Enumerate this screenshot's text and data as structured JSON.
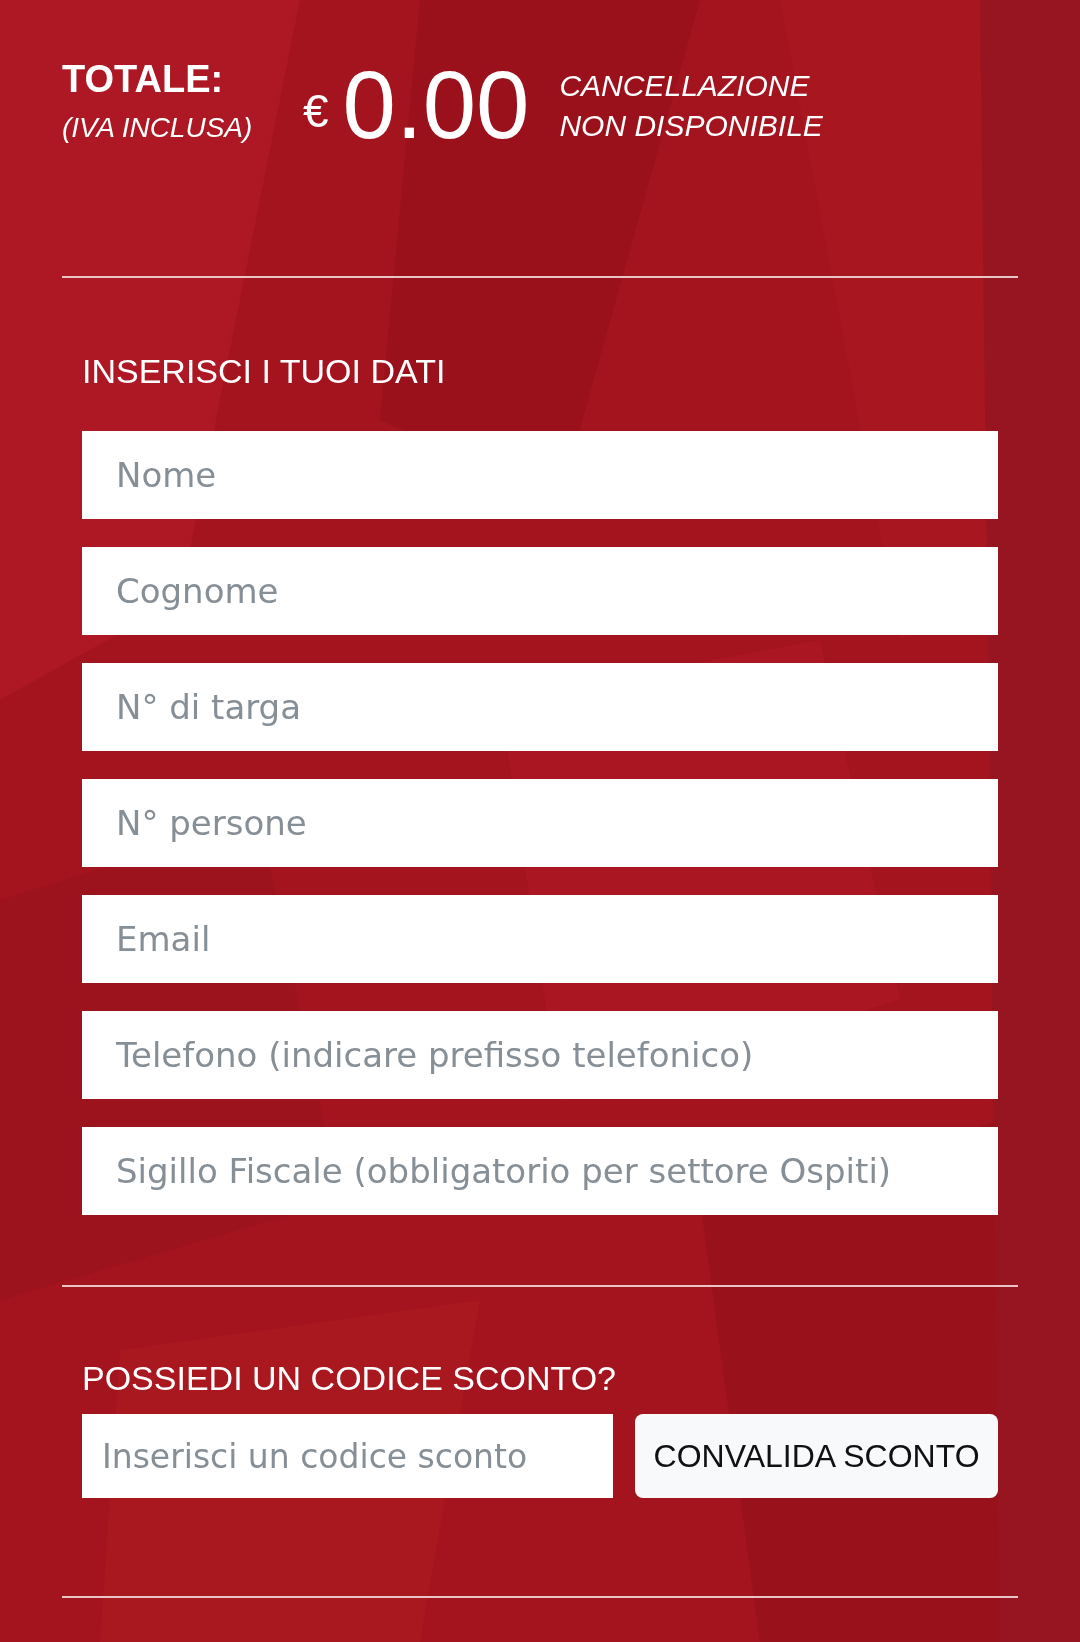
{
  "total": {
    "label": "TOTALE:",
    "note": "(IVA INCLUSA)",
    "currency": "€",
    "amount": "0.00",
    "cancellation": [
      "CANCELLAZIONE",
      "NON DISPONIBILE"
    ]
  },
  "form": {
    "title": "INSERISCI I TUOI DATI",
    "fields": [
      {
        "placeholder": "Nome"
      },
      {
        "placeholder": "Cognome"
      },
      {
        "placeholder": "N° di targa"
      },
      {
        "placeholder": "N° persone"
      },
      {
        "placeholder": "Email"
      },
      {
        "placeholder": "Telefono (indicare prefisso telefonico)"
      },
      {
        "placeholder": "Sigillo Fiscale (obbligatorio per settore Ospiti)"
      }
    ]
  },
  "discount": {
    "title": "POSSIEDI UN CODICE SCONTO?",
    "placeholder": "Inserisci un codice sconto",
    "button": "CONVALIDA SCONTO"
  }
}
